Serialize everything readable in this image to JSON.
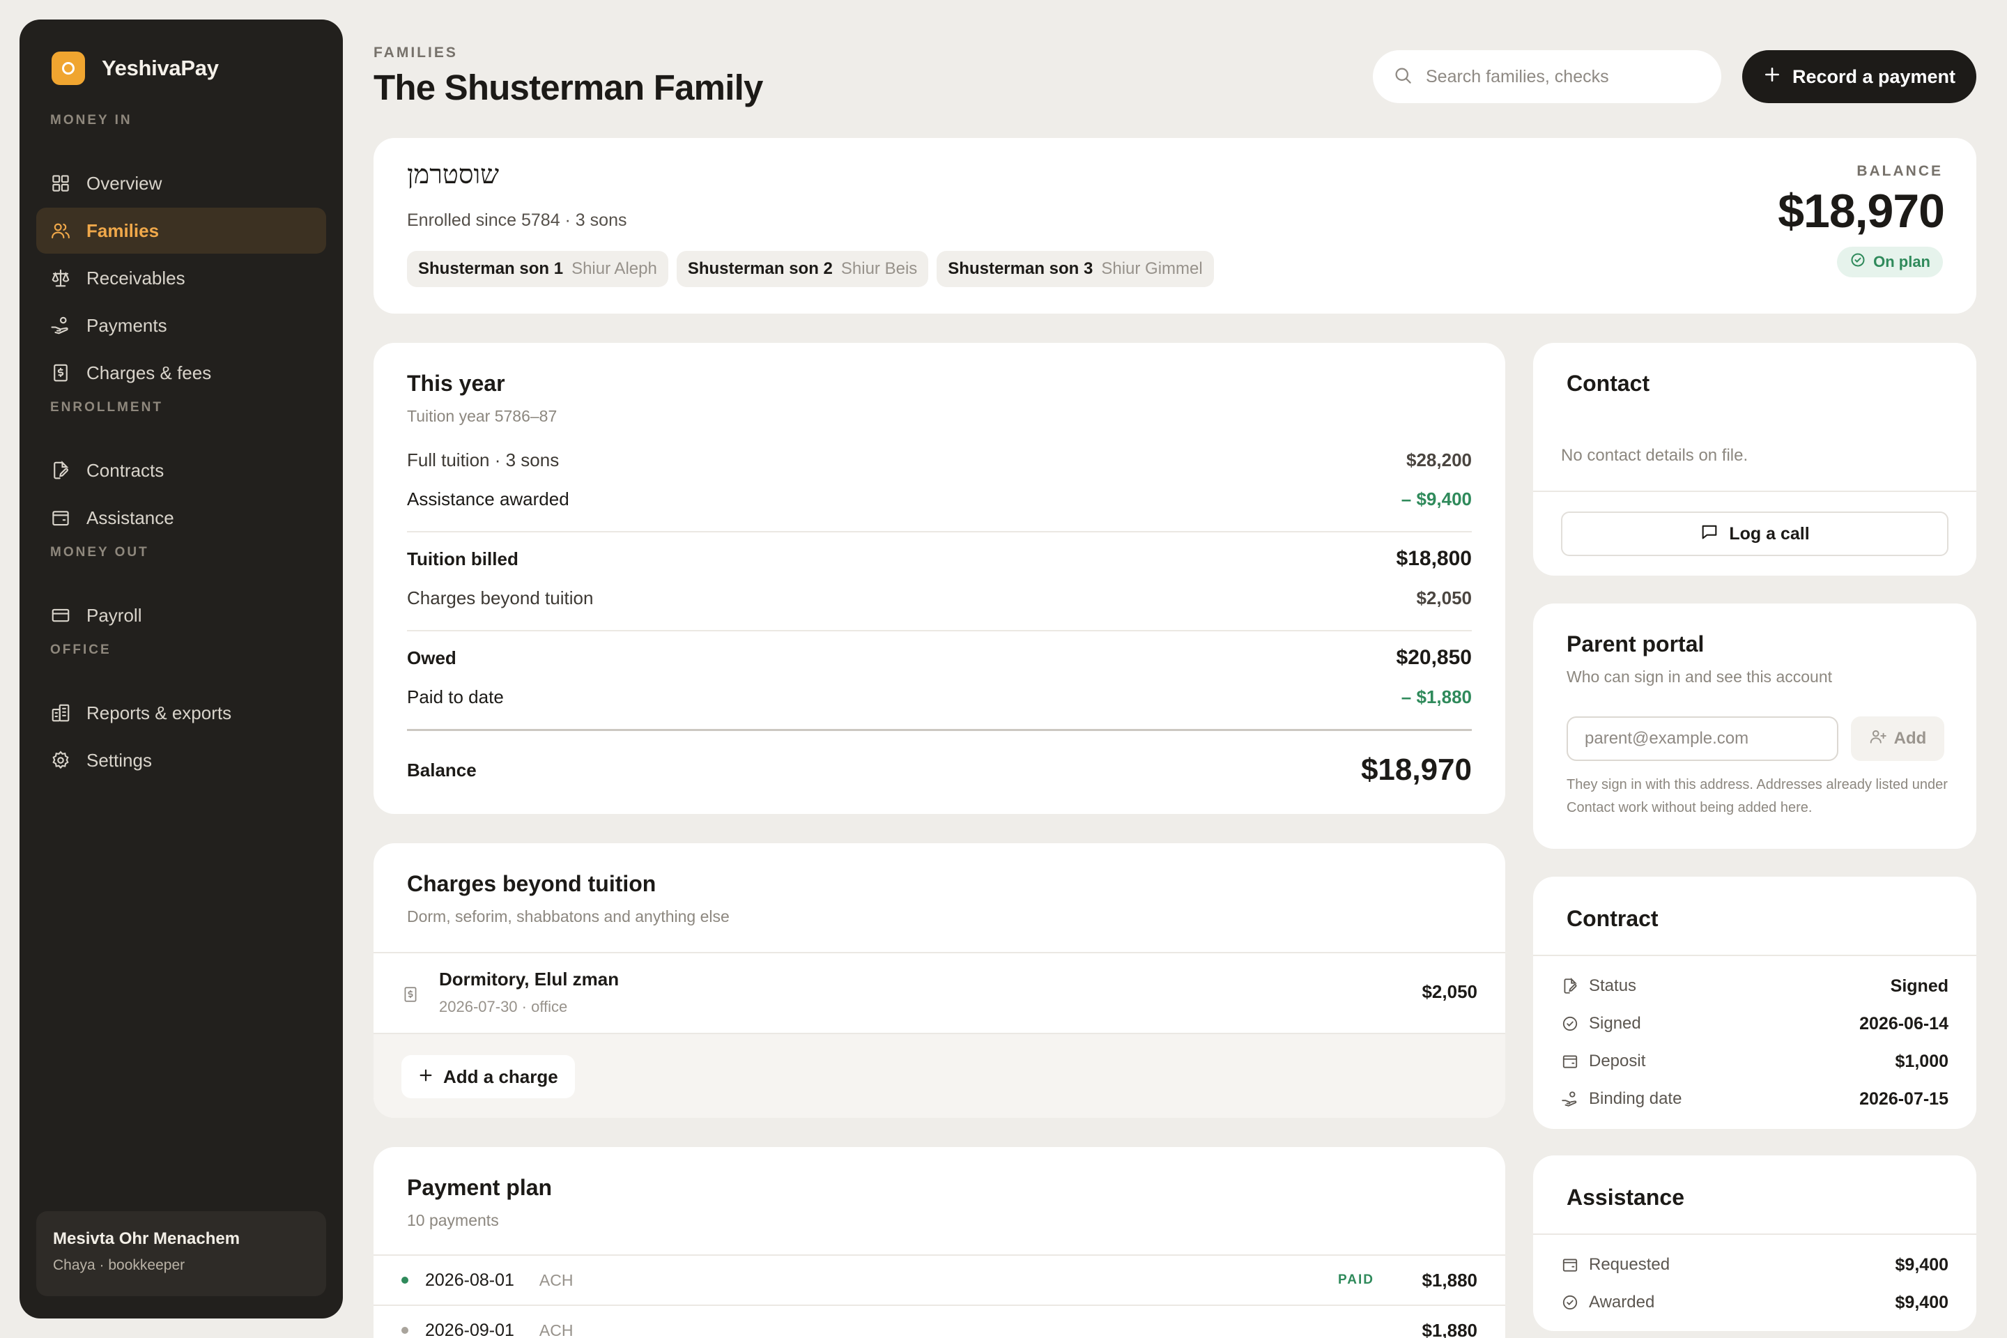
{
  "brand": {
    "name": "YeshivaPay"
  },
  "sidebar": {
    "sections": [
      {
        "label": "MONEY IN"
      },
      {
        "label": "ENROLLMENT"
      },
      {
        "label": "MONEY OUT"
      },
      {
        "label": "OFFICE"
      }
    ],
    "items": [
      {
        "label": "Overview",
        "icon": "grid-icon"
      },
      {
        "label": "Families",
        "icon": "users-icon",
        "active": true
      },
      {
        "label": "Receivables",
        "icon": "scale-icon"
      },
      {
        "label": "Payments",
        "icon": "hand-coins-icon"
      },
      {
        "label": "Charges & fees",
        "icon": "receipt-icon"
      },
      {
        "label": "Contracts",
        "icon": "file-signature-icon"
      },
      {
        "label": "Assistance",
        "icon": "wallet-icon"
      },
      {
        "label": "Payroll",
        "icon": "credit-card-icon"
      },
      {
        "label": "Reports & exports",
        "icon": "building-chart-icon"
      },
      {
        "label": "Settings",
        "icon": "gear-icon"
      }
    ],
    "org": {
      "name": "Mesivta Ohr Menachem",
      "user": "Chaya · bookkeeper"
    }
  },
  "header": {
    "eyebrow": "FAMILIES",
    "title": "The Shusterman Family",
    "search_placeholder": "Search families, checks",
    "record_label": "Record a payment"
  },
  "family": {
    "hebrew_name": "שוסטרמן",
    "enrolled": "Enrolled since 5784 · 3 sons",
    "sons": [
      {
        "name": "Shusterman son 1",
        "shiur": "Shiur Aleph"
      },
      {
        "name": "Shusterman son 2",
        "shiur": "Shiur Beis"
      },
      {
        "name": "Shusterman son 3",
        "shiur": "Shiur Gimmel"
      }
    ],
    "balance_label": "BALANCE",
    "balance": "$18,970",
    "status": "On plan"
  },
  "this_year": {
    "title": "This year",
    "subtitle": "Tuition year 5786–87",
    "full_tuition": {
      "label": "Full tuition · 3 sons",
      "amount": "$28,200"
    },
    "assistance": {
      "label": "Assistance awarded",
      "amount": "– $9,400"
    },
    "tuition_billed": {
      "label": "Tuition billed",
      "amount": "$18,800"
    },
    "charges": {
      "label": "Charges beyond tuition",
      "amount": "$2,050"
    },
    "owed": {
      "label": "Owed",
      "amount": "$20,850"
    },
    "paid": {
      "label": "Paid to date",
      "amount": "– $1,880"
    },
    "balance": {
      "label": "Balance",
      "amount": "$18,970"
    }
  },
  "charges": {
    "title": "Charges beyond tuition",
    "subtitle": "Dorm, seforim, shabbatons and anything else",
    "items": [
      {
        "name": "Dormitory, Elul zman",
        "meta": "2026-07-30 · office",
        "amount": "$2,050"
      }
    ],
    "add_label": "Add a charge"
  },
  "payment_plan": {
    "title": "Payment plan",
    "subtitle": "10 payments",
    "rows": [
      {
        "date": "2026-08-01",
        "method": "ACH",
        "status": "PAID",
        "amount": "$1,880",
        "dot_color": "#2f8a5b"
      },
      {
        "date": "2026-09-01",
        "method": "ACH",
        "status": "",
        "amount": "$1,880",
        "dot_color": "#a9a49c"
      }
    ]
  },
  "contact": {
    "title": "Contact",
    "empty": "No contact details on file.",
    "log_call_label": "Log a call"
  },
  "portal": {
    "title": "Parent portal",
    "subtitle": "Who can sign in and see this account",
    "email_placeholder": "parent@example.com",
    "add_label": "Add",
    "note": "They sign in with this address. Addresses already listed under Contact work without being added here."
  },
  "contract": {
    "title": "Contract",
    "status": {
      "label": "Status",
      "value": "Signed"
    },
    "signed": {
      "label": "Signed",
      "value": "2026-06-14"
    },
    "deposit": {
      "label": "Deposit",
      "value": "$1,000"
    },
    "binding": {
      "label": "Binding date",
      "value": "2026-07-15"
    }
  },
  "assistance": {
    "title": "Assistance",
    "requested": {
      "label": "Requested",
      "value": "$9,400"
    },
    "awarded": {
      "label": "Awarded",
      "value": "$9,400"
    }
  },
  "colors": {
    "accent": "#f0a530",
    "positive": "#2f8a5b",
    "sidebar": "#22201d"
  }
}
